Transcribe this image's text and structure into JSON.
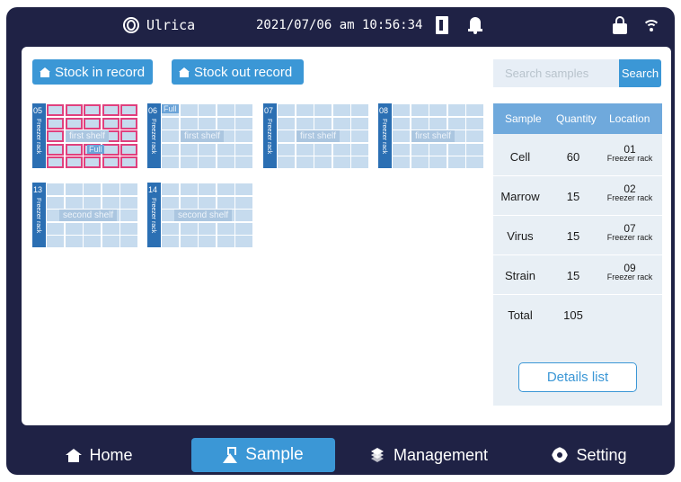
{
  "status_bar": {
    "user": "Ulrica",
    "datetime": "2021/07/06 am 10:56:34",
    "icons": [
      "user-icon",
      "door-icon",
      "bell-icon",
      "lock-icon",
      "wifi-icon"
    ]
  },
  "toolbar": {
    "stock_in": "Stock in record",
    "stock_out": "Stock out record"
  },
  "search": {
    "placeholder": "Search samples",
    "button": "Search"
  },
  "racks": [
    {
      "number": "05",
      "label": "Freezer rack",
      "shelf": "first shelf",
      "badge": "Full",
      "full": true
    },
    {
      "number": "06",
      "label": "Freezer rack",
      "shelf": "first shelf",
      "badge": "Full",
      "full": false
    },
    {
      "number": "07",
      "label": "Freezer rack",
      "shelf": "first shelf",
      "badge": "",
      "full": false
    },
    {
      "number": "08",
      "label": "Freezer rack",
      "shelf": "first shelf",
      "badge": "",
      "full": false
    },
    {
      "number": "13",
      "label": "Freezer rack",
      "shelf": "second shelf",
      "badge": "",
      "full": false
    },
    {
      "number": "14",
      "label": "Freezer rack",
      "shelf": "second shelf",
      "badge": "",
      "full": false
    }
  ],
  "table": {
    "headers": [
      "Sample",
      "Quantity",
      "Location"
    ],
    "rows": [
      {
        "sample": "Cell",
        "quantity": "60",
        "location": "01",
        "location_sub": "Freezer rack"
      },
      {
        "sample": "Marrow",
        "quantity": "15",
        "location": "02",
        "location_sub": "Freezer rack"
      },
      {
        "sample": "Virus",
        "quantity": "15",
        "location": "07",
        "location_sub": "Freezer rack"
      },
      {
        "sample": "Strain",
        "quantity": "15",
        "location": "09",
        "location_sub": "Freezer rack"
      }
    ],
    "total_label": "Total",
    "total_value": "105",
    "details_button": "Details list"
  },
  "nav": {
    "home": "Home",
    "sample": "Sample",
    "management": "Management",
    "setting": "Setting",
    "active": "Sample"
  },
  "colors": {
    "frame": "#1f2245",
    "accent": "#3b97d6",
    "rack_side": "#2b6fb3",
    "cell": "#c6dbee",
    "full_border": "#e0407e"
  }
}
